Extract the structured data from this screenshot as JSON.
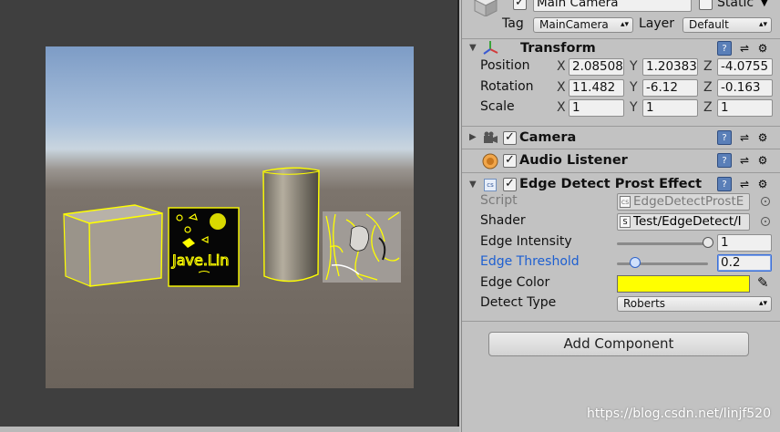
{
  "header": {
    "object_name": "Main Camera",
    "static_label": "Static",
    "tag_label": "Tag",
    "tag_value": "MainCamera",
    "layer_label": "Layer",
    "layer_value": "Default"
  },
  "transform": {
    "title": "Transform",
    "position": {
      "label": "Position",
      "x": "2.08508",
      "y": "1.20383",
      "z": "-4.0755"
    },
    "rotation": {
      "label": "Rotation",
      "x": "11.482",
      "y": "-6.12",
      "z": "-0.163"
    },
    "scale": {
      "label": "Scale",
      "x": "1",
      "y": "1",
      "z": "1"
    },
    "axes": {
      "x": "X",
      "y": "Y",
      "z": "Z"
    }
  },
  "components": {
    "camera": "Camera",
    "audio_listener": "Audio Listener",
    "edge_effect": "Edge Detect Prost Effect"
  },
  "edge_effect": {
    "script_label": "Script",
    "script_value": "EdgeDetectProstE",
    "shader_label": "Shader",
    "shader_value": "Test/EdgeDetect/I",
    "intensity_label": "Edge Intensity",
    "intensity_value": "1",
    "intensity_level": 1.0,
    "threshold_label": "Edge Threshold",
    "threshold_value": "0.2",
    "threshold_level": 0.2,
    "color_label": "Edge Color",
    "edge_color": "#ffff00",
    "detect_label": "Detect Type",
    "detect_value": "Roberts"
  },
  "add_component_label": "Add Component",
  "scene": {
    "texture_text": "Jave.Lin"
  },
  "watermark": "https://blog.csdn.net/linjf520"
}
